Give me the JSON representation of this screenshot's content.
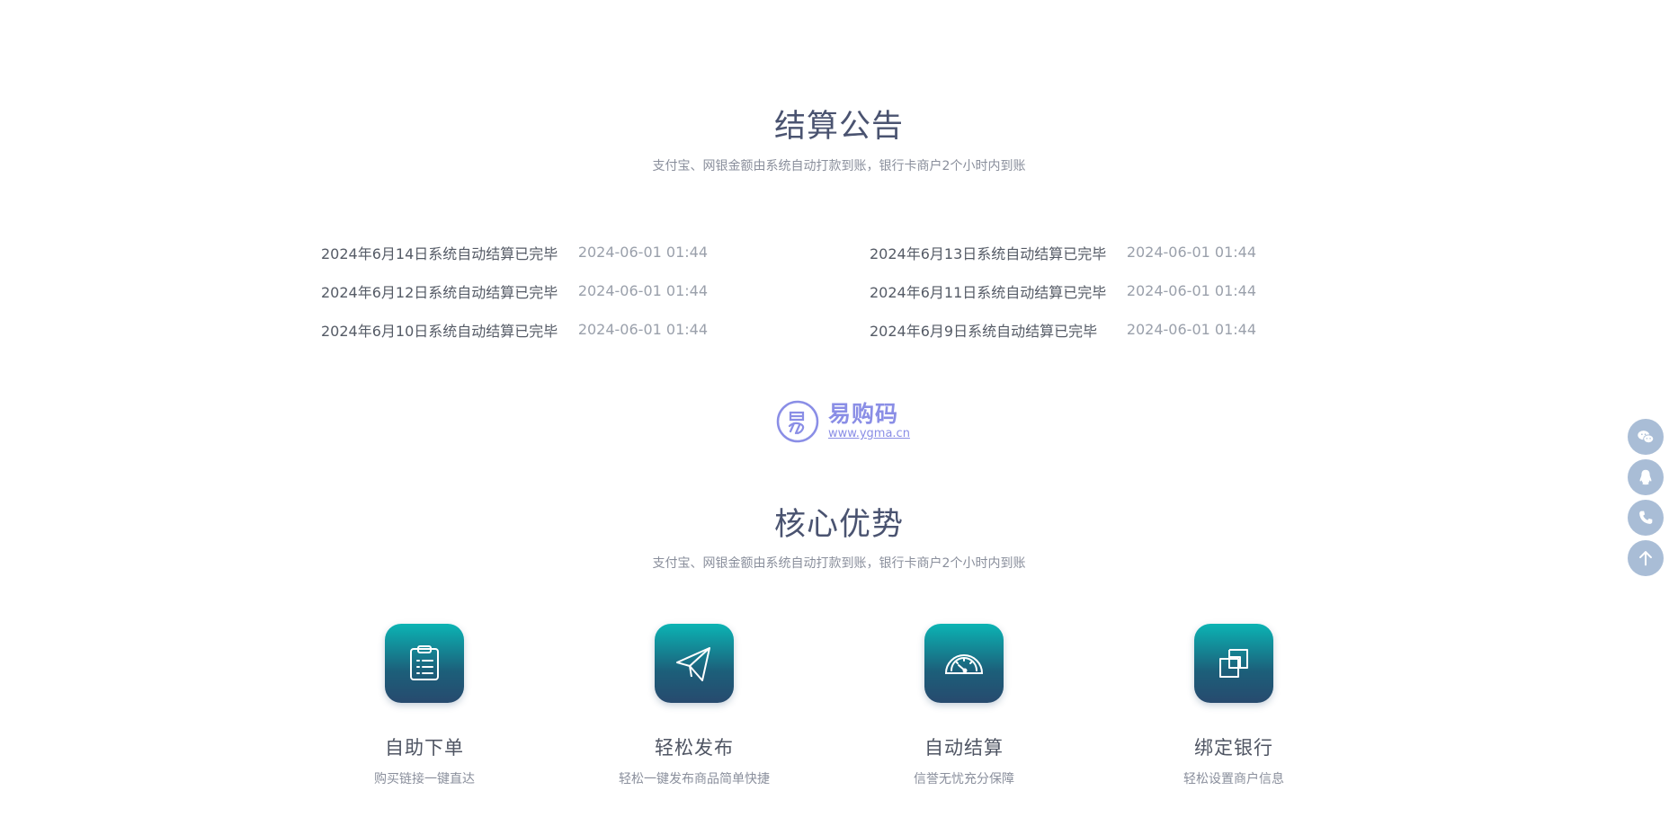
{
  "announcement": {
    "title": "结算公告",
    "subtitle": "支付宝、网银金额由系统自动打款到账，银行卡商户2个小时内到账",
    "items": [
      {
        "title": "2024年6月14日系统自动结算已完毕",
        "date": "2024-06-01 01:44"
      },
      {
        "title": "2024年6月13日系统自动结算已完毕",
        "date": "2024-06-01 01:44"
      },
      {
        "title": "2024年6月12日系统自动结算已完毕",
        "date": "2024-06-01 01:44"
      },
      {
        "title": "2024年6月11日系统自动结算已完毕",
        "date": "2024-06-01 01:44"
      },
      {
        "title": "2024年6月10日系统自动结算已完毕",
        "date": "2024-06-01 01:44"
      },
      {
        "title": "2024年6月9日系统自动结算已完毕",
        "date": "2024-06-01 01:44"
      }
    ]
  },
  "logo": {
    "name": "易购码",
    "url_text": "www.ygma.cn",
    "color": "#8a8ee6"
  },
  "advantages": {
    "title": "核心优势",
    "subtitle": "支付宝、网银金额由系统自动打款到账，银行卡商户2个小时内到账",
    "items": [
      {
        "icon": "clipboard-icon",
        "title": "自助下单",
        "desc": "购买链接一键直达"
      },
      {
        "icon": "paper-plane-icon",
        "title": "轻松发布",
        "desc": "轻松一键发布商品简单快捷"
      },
      {
        "icon": "speedometer-icon",
        "title": "自动结算",
        "desc": "信誉无忧充分保障"
      },
      {
        "icon": "link-squares-icon",
        "title": "绑定银行",
        "desc": "轻松设置商户信息"
      }
    ]
  },
  "float_bar": {
    "buttons": [
      "wechat-icon",
      "qq-icon",
      "phone-icon",
      "back-to-top-icon"
    ],
    "color": "#a9bdd6"
  }
}
